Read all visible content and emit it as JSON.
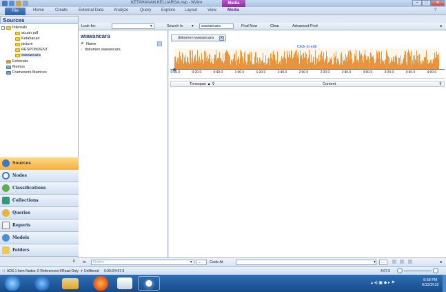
{
  "window": {
    "title": "KETAHANAN KELUARGA.nvp - NVivo",
    "context_tab": "Media"
  },
  "ribbon": {
    "file": "File",
    "tabs": [
      "Home",
      "Create",
      "External Data",
      "Analyze",
      "Query",
      "Explore",
      "Layout",
      "View",
      "Media"
    ]
  },
  "left": {
    "header": "Sources",
    "tree": [
      {
        "label": "Internals",
        "level": 0,
        "expanded": true
      },
      {
        "label": "acuan pdf",
        "level": 1
      },
      {
        "label": "Ketahanan",
        "level": 1
      },
      {
        "label": "picture",
        "level": 1
      },
      {
        "label": "RESPONDENT",
        "level": 1
      },
      {
        "label": "wawancara",
        "level": 1
      },
      {
        "label": "Externals",
        "level": 0
      },
      {
        "label": "Memos",
        "level": 0
      },
      {
        "label": "Framework Matrices",
        "level": 0
      }
    ],
    "nav": [
      "Sources",
      "Nodes",
      "Classifications",
      "Collections",
      "Queries",
      "Reports",
      "Models",
      "Folders"
    ]
  },
  "findbar": {
    "look_for_label": "Look for:",
    "search_in_label": "Search In",
    "search_in_value": "wawancara",
    "find_now": "Find Now",
    "clear": "Clear",
    "advanced_find": "Advanced Find"
  },
  "list": {
    "title": "wawancara",
    "column_name": "Name",
    "items": [
      "dokumen wawancara"
    ]
  },
  "detail": {
    "tab_label": "dokumen wawancara",
    "click_to_edit": "Click to edit",
    "timeline_ticks": [
      "0:00.0",
      "0:20.0",
      "0:40.0",
      "1:00.0",
      "1:20.0",
      "1:40.0",
      "2:00.0",
      "2:20.0",
      "2:40.0",
      "3:00.0",
      "3:20.0",
      "3:40.0",
      "4:00.0"
    ],
    "columns": {
      "timespan": "Timespan",
      "content": "Content"
    }
  },
  "bottombar": {
    "in_label": "In",
    "in_placeholder": "Nodes",
    "code_at": "Code At"
  },
  "status": {
    "text": "ADS  1 Item  Nodes: 0  References: 0",
    "readonly": "Read-Only",
    "unfiltered": "Unfiltered",
    "timecode": "0:00.0/4:07.9",
    "right_time": "4:07.9"
  },
  "taskbar": {
    "time": "9:58 PM",
    "date": "6/13/2019"
  },
  "colors": {
    "accent": "#f7b13b",
    "media_tab": "#8d2ea3",
    "waveform": "#e7892a",
    "taskbar": "#174b89"
  }
}
